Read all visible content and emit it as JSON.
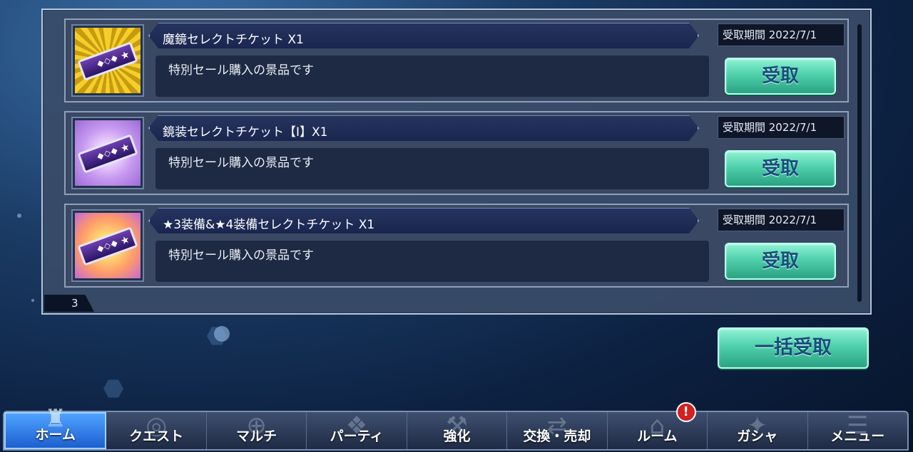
{
  "rewards": [
    {
      "title": "魔鏡セレクトチケット X1",
      "description": "特別セール購入の景品です",
      "expiry": "受取期間 2022/7/1",
      "button_label": "受取",
      "icon": "ticket-gold-icon",
      "ticket_glyph": "◆◇◆"
    },
    {
      "title": "鏡装セレクトチケット【Ⅰ】X1",
      "description": "特別セール購入の景品です",
      "expiry": "受取期間 2022/7/1",
      "button_label": "受取",
      "icon": "ticket-purple-icon",
      "ticket_glyph": "◆◇◆"
    },
    {
      "title": "★3装備&★4装備セレクトチケット X1",
      "description": "特別セール購入の景品です",
      "expiry": "受取期間 2022/7/1",
      "button_label": "受取",
      "icon": "ticket-rainbow-icon",
      "ticket_glyph": "◆◇◆"
    }
  ],
  "item_count": "3",
  "bulk_button_label": "一括受取",
  "nav": [
    {
      "label": "ホーム",
      "icon": "home-icon",
      "glyph": "♜",
      "active": true
    },
    {
      "label": "クエスト",
      "icon": "quest-icon",
      "glyph": "◎"
    },
    {
      "label": "マルチ",
      "icon": "multi-icon",
      "glyph": "⊕"
    },
    {
      "label": "パーティ",
      "icon": "party-icon",
      "glyph": "❖"
    },
    {
      "label": "強化",
      "icon": "enhance-icon",
      "glyph": "⚒"
    },
    {
      "label": "交換・売却",
      "icon": "exchange-icon",
      "glyph": "⇄"
    },
    {
      "label": "ルーム",
      "icon": "room-icon",
      "glyph": "⌂",
      "badge": "!"
    },
    {
      "label": "ガシャ",
      "icon": "gacha-icon",
      "glyph": "✦"
    },
    {
      "label": "メニュー",
      "icon": "menu-icon",
      "glyph": "☰"
    }
  ],
  "colors": {
    "accent_green": "#4fd0ab",
    "button_text": "#174d7a",
    "alert": "#d32020",
    "active_tab": "#1d5fd0"
  }
}
